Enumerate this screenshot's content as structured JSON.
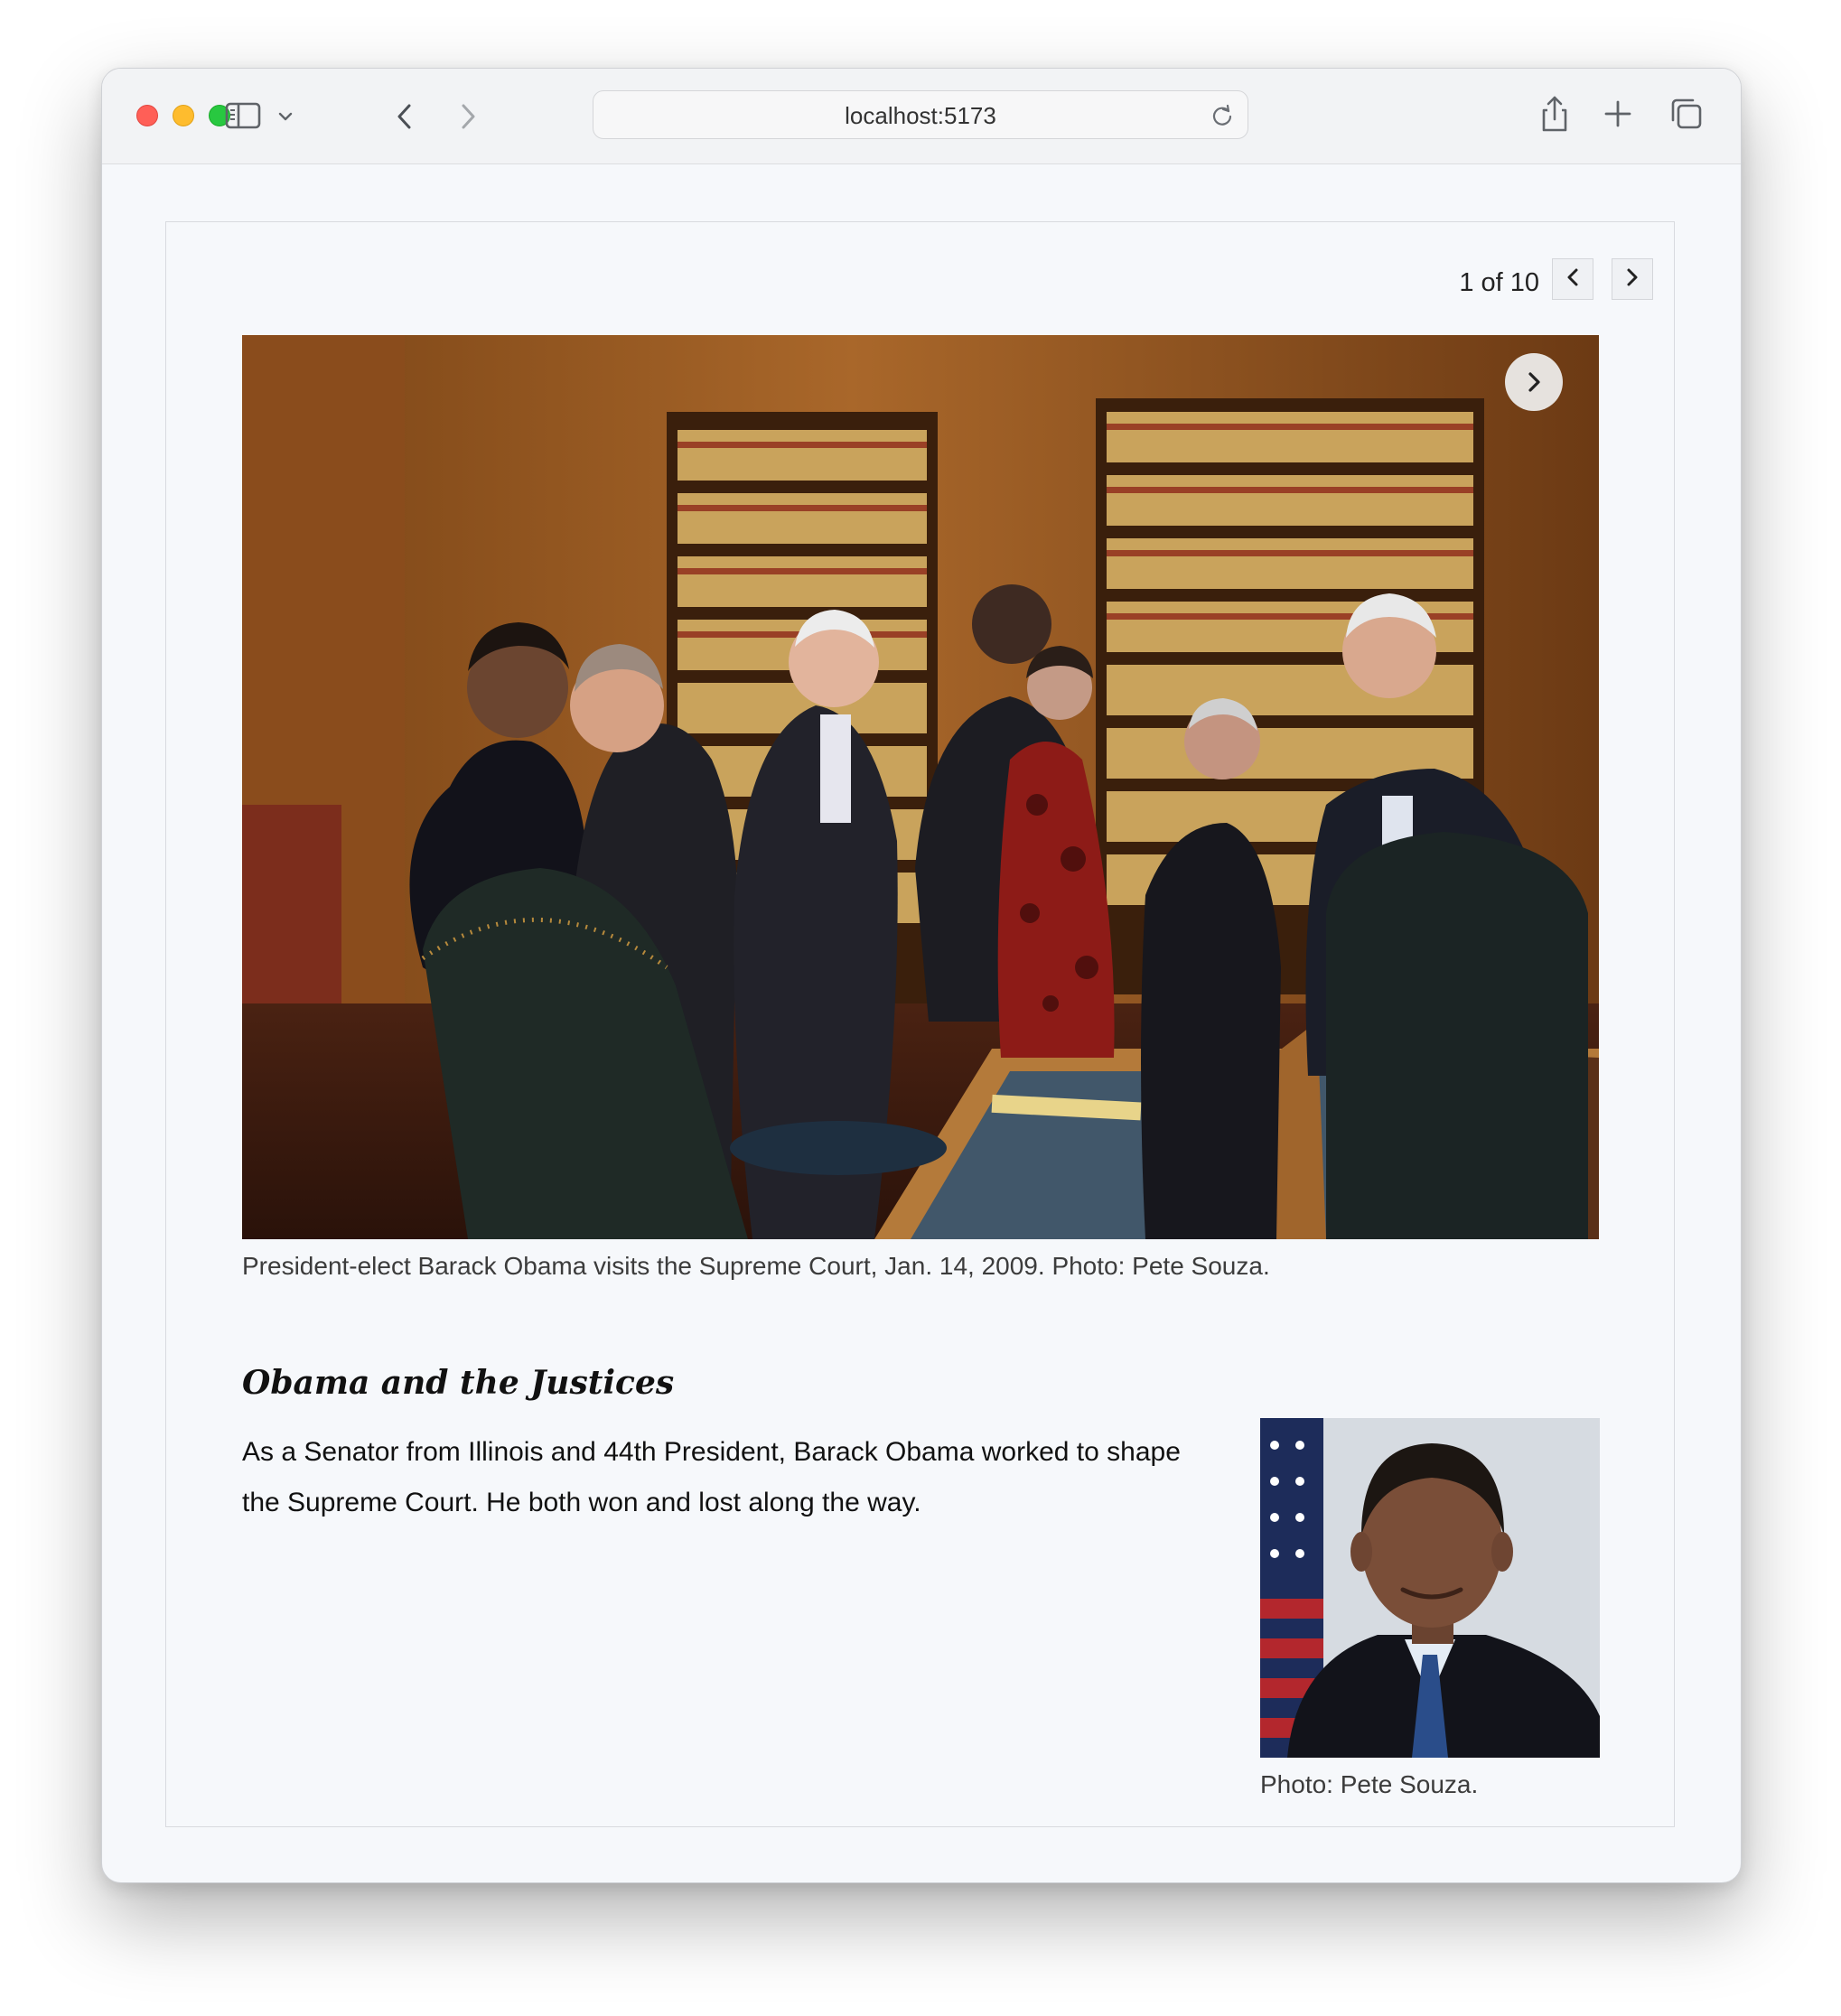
{
  "browser": {
    "url": "localhost:5173",
    "icons": {
      "sidebar": "sidebar-icon",
      "chevron": "chevron-down-icon",
      "back": "back-arrow-icon",
      "forward": "forward-arrow-icon",
      "reload": "reload-icon",
      "share": "share-icon",
      "new_tab": "plus-icon",
      "tabs": "tab-overview-icon"
    }
  },
  "slideshow": {
    "counter": "1 of 10",
    "current": 1,
    "total": 10,
    "hero_caption": "President-elect Barack Obama visits the Supreme Court, Jan. 14, 2009. Photo: Pete Souza."
  },
  "article": {
    "title": "Obama and the Justices",
    "body": "As a Senator from Illinois and 44th President, Barack Obama worked to shape the Supreme Court. He both won and lost along the way.",
    "portrait_caption": "Photo: Pete Souza."
  },
  "colors": {
    "page_bg": "#f6f8fb",
    "traffic_red": "#ff5f57",
    "traffic_yellow": "#febc2e",
    "traffic_green": "#28c840"
  }
}
